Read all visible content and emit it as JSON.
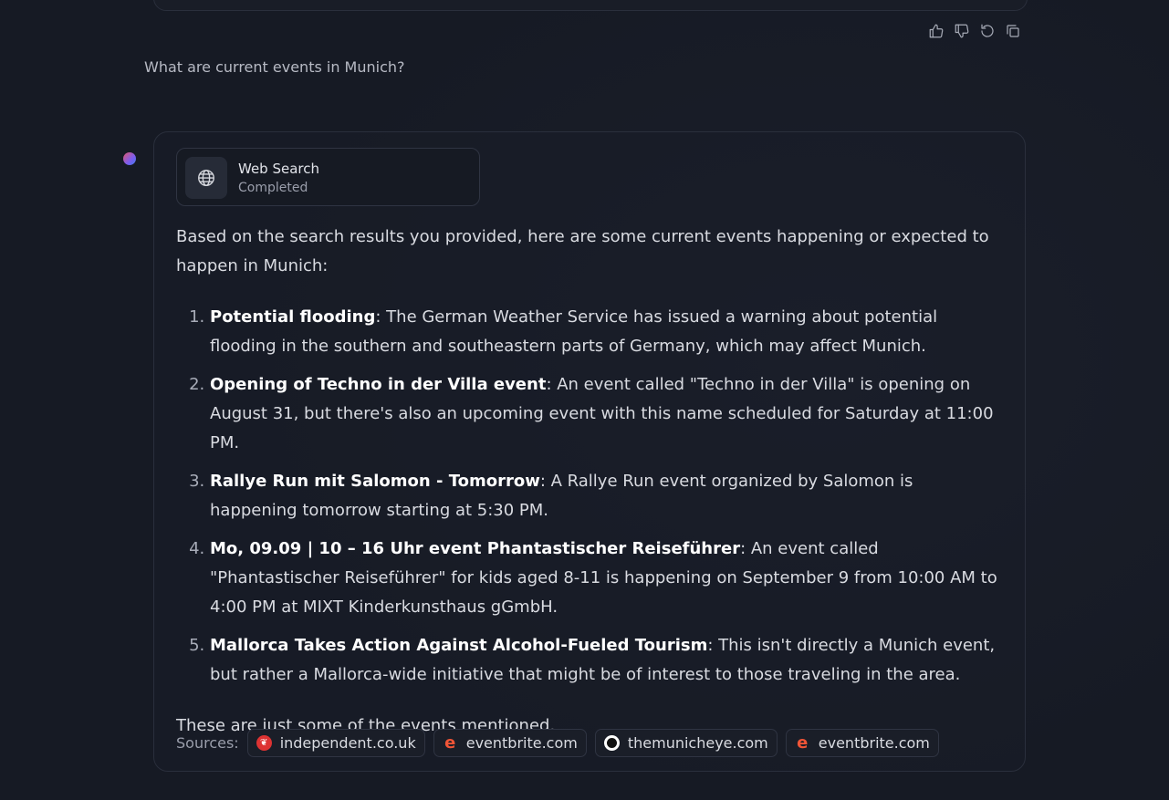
{
  "previous_actions": {
    "like_icon": "thumbs-up-icon",
    "dislike_icon": "thumbs-down-icon",
    "retry_icon": "retry-icon",
    "copy_icon": "copy-icon"
  },
  "user_message": "What are current events in Munich?",
  "tool": {
    "title": "Web Search",
    "status": "Completed",
    "icon": "globe-icon"
  },
  "response": {
    "intro": "Based on the search results you provided, here are some current events happening or expected to happen in Munich:",
    "items": [
      {
        "title": "Potential flooding",
        "text": ": The German Weather Service has issued a warning about potential flooding in the southern and southeastern parts of Germany, which may affect Munich."
      },
      {
        "title": "Opening of Techno in der Villa event",
        "text": ": An event called \"Techno in der Villa\" is opening on August 31, but there's also an upcoming event with this name scheduled for Saturday at 11:00 PM."
      },
      {
        "title": "Rallye Run mit Salomon - Tomorrow",
        "text": ": A Rallye Run event organized by Salomon is happening tomorrow starting at 5:30 PM."
      },
      {
        "title": "Mo, 09.09 | 10 – 16 Uhr event Phantastischer Reiseführer",
        "text": ": An event called \"Phantastischer Reiseführer\" for kids aged 8-11 is happening on September 9 from 10:00 AM to 4:00 PM at MIXT Kinderkunsthaus gGmbH."
      },
      {
        "title": "Mallorca Takes Action Against Alcohol-Fueled Tourism",
        "text": ": This isn't directly a Munich event, but rather a Mallorca-wide initiative that might be of interest to those traveling in the area."
      }
    ],
    "closing": "These are just some of the events mentioned."
  },
  "sources": {
    "label": "Sources:",
    "items": [
      {
        "name": "independent.co.uk",
        "favicon": "independent-favicon"
      },
      {
        "name": "eventbrite.com",
        "favicon": "eventbrite-favicon"
      },
      {
        "name": "themunicheye.com",
        "favicon": "themunicheye-favicon"
      },
      {
        "name": "eventbrite.com",
        "favicon": "eventbrite-favicon"
      }
    ]
  },
  "colors": {
    "background": "#161a24",
    "card_border": "#2a2f3c",
    "eventbrite": "#f05537",
    "independent": "#dd3333"
  }
}
